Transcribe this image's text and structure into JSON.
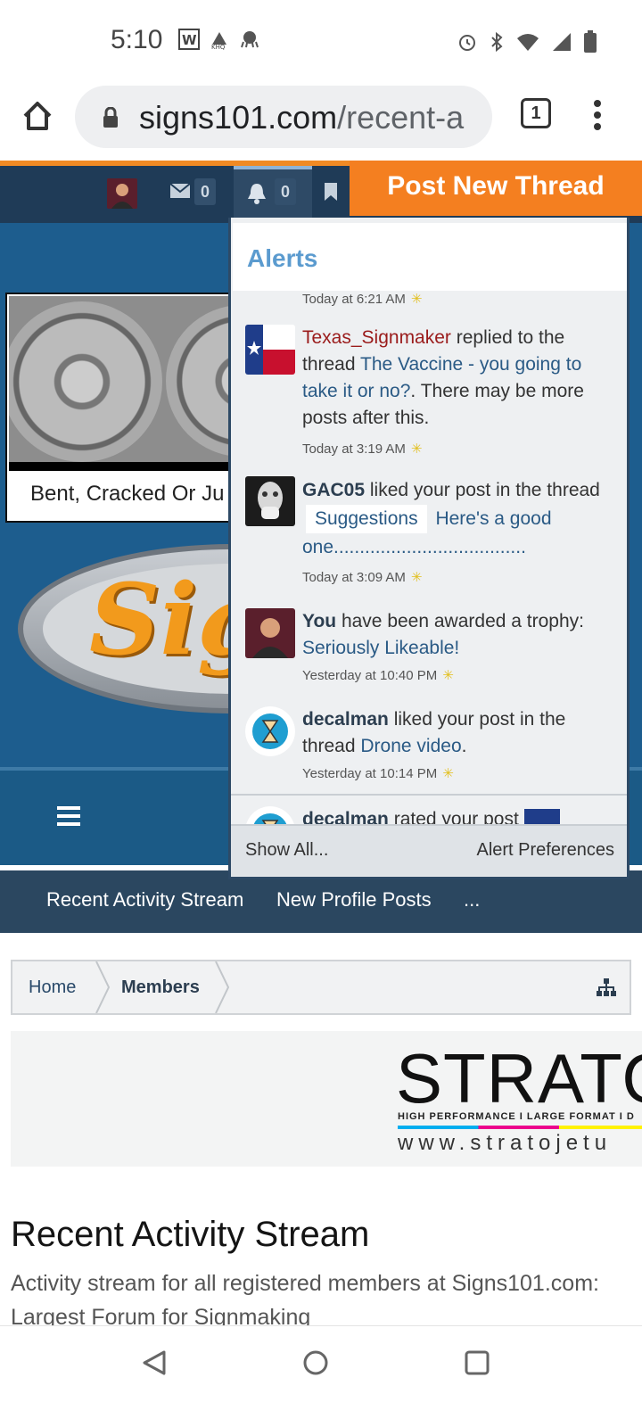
{
  "status_bar": {
    "time": "5:10",
    "icons_left": [
      "w-icon",
      "nbc-icon",
      "octopus-icon"
    ],
    "icons_right": [
      "alarm-icon",
      "bluetooth-icon",
      "wifi-icon",
      "signal-icon",
      "battery-icon"
    ]
  },
  "browser": {
    "url_main": "signs101.com",
    "url_path": "/recent-a",
    "tab_count": "1"
  },
  "site_nav": {
    "mail_count": "0",
    "alerts_count": "0",
    "post_thread_label": "Post New Thread"
  },
  "banner": {
    "ad_caption": "Bent, Cracked Or Ju",
    "logo_text": "Sig"
  },
  "subnav": {
    "items": [
      "Recent Activity Stream",
      "New Profile Posts",
      "..."
    ]
  },
  "breadcrumb": {
    "items": [
      "Home",
      "Members"
    ]
  },
  "strato_ad": {
    "logo": "STRATOJ",
    "tagline": "HIGH PERFORMANCE  I  LARGE FORMAT  I  D",
    "url": "www.stratojetu"
  },
  "page": {
    "title": "Recent Activity Stream",
    "description": "Activity stream for all registered members at Signs101.com: Largest Forum for Signmaking"
  },
  "alerts": {
    "title": "Alerts",
    "first_time": "Today at 6:21 AM",
    "items": [
      {
        "user": "Texas_Signmaker",
        "action": " replied to the thread ",
        "link": "The Vaccine - you going to take it or no?",
        "suffix": ". There may be more posts after this.",
        "time": "Today at 3:19 AM"
      },
      {
        "user": "GAC05",
        "action": " liked your post in the thread ",
        "chip": "Suggestions",
        "link": "Here's a good one.....................................",
        "time": "Today at 3:09 AM"
      },
      {
        "user": "You",
        "action": " have been awarded a trophy: ",
        "link": "Seriously Likeable!",
        "time": "Yesterday at 10:40 PM"
      },
      {
        "user": "decalman",
        "action": " liked your post in the thread ",
        "link": "Drone video",
        "suffix": ".",
        "time": "Yesterday at 10:14 PM"
      },
      {
        "user": "decalman",
        "action": " rated your post"
      }
    ],
    "footer_left": "Show All...",
    "footer_right": "Alert Preferences"
  },
  "colors": {
    "accent_orange": "#f47f20",
    "nav_dark": "#1f3b57",
    "banner_blue": "#1d5d8e",
    "alert_title": "#5b9bcf"
  }
}
